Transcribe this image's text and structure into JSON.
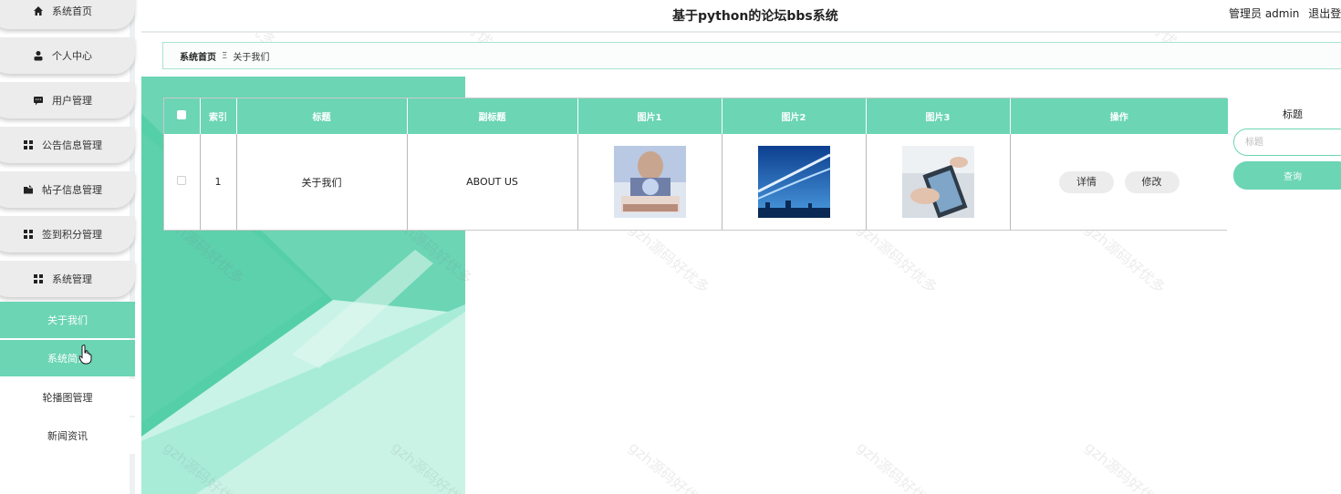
{
  "header": {
    "title": "基于python的论坛bbs系统",
    "user_role": "管理员 admin",
    "logout": "退出登"
  },
  "sidebar": {
    "menu": [
      {
        "label": "系统首页",
        "icon": "home-icon"
      },
      {
        "label": "个人中心",
        "icon": "user-icon"
      },
      {
        "label": "用户管理",
        "icon": "chat-icon"
      },
      {
        "label": "公告信息管理",
        "icon": "grid-icon"
      },
      {
        "label": "帖子信息管理",
        "icon": "folder-icon"
      },
      {
        "label": "签到积分管理",
        "icon": "grid-icon"
      },
      {
        "label": "系统管理",
        "icon": "grid-icon"
      }
    ],
    "submenu": [
      {
        "label": "关于我们",
        "state": "active"
      },
      {
        "label": "系统简介",
        "state": "hover"
      },
      {
        "label": "轮播图管理",
        "state": "normal"
      },
      {
        "label": "新闻资讯",
        "state": "normal"
      }
    ]
  },
  "breadcrumb": {
    "home": "系统首页",
    "separator": "Ξ",
    "current": "关于我们"
  },
  "table": {
    "headers": [
      "",
      "索引",
      "标题",
      "副标题",
      "图片1",
      "图片2",
      "图片3",
      "操作"
    ],
    "rows": [
      {
        "index": "1",
        "title": "关于我们",
        "subtitle": "ABOUT US",
        "actions": [
          "详情",
          "修改"
        ]
      }
    ]
  },
  "search": {
    "label": "标题",
    "placeholder": "标题",
    "button": "查询"
  },
  "watermark": "gzh源码好优多",
  "colors": {
    "accent": "#6bd5b4",
    "menu_bg": "#ececec"
  }
}
